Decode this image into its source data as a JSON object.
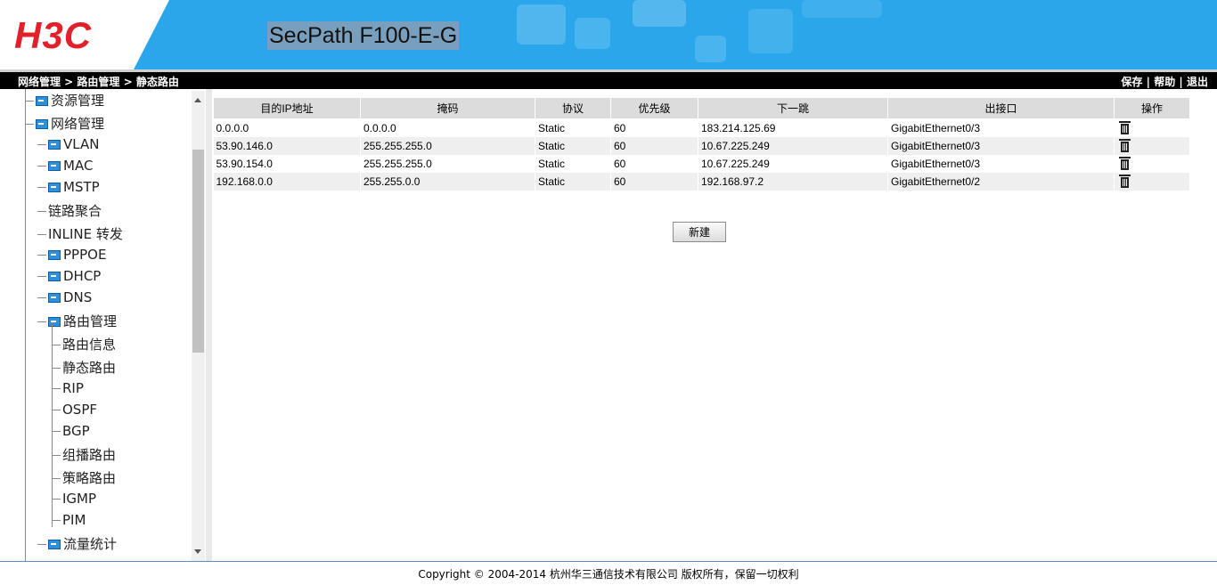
{
  "header": {
    "logo": "H3C",
    "device_title": "SecPath F100-E-G"
  },
  "breadcrumb": "网络管理 > 路由管理 > 静态路由",
  "toplinks": {
    "save": "保存",
    "help": "帮助",
    "logout": "退出",
    "sep": "|"
  },
  "sidebar": {
    "items": [
      {
        "label": "资源管理",
        "level": 0,
        "icon": true
      },
      {
        "label": "网络管理",
        "level": 0,
        "icon": true
      },
      {
        "label": "VLAN",
        "level": 1,
        "icon": true
      },
      {
        "label": "MAC",
        "level": 1,
        "icon": true
      },
      {
        "label": "MSTP",
        "level": 1,
        "icon": true
      },
      {
        "label": "链路聚合",
        "level": 1,
        "icon": false
      },
      {
        "label": "INLINE 转发",
        "level": 1,
        "icon": false
      },
      {
        "label": "PPPOE",
        "level": 1,
        "icon": true
      },
      {
        "label": "DHCP",
        "level": 1,
        "icon": true
      },
      {
        "label": "DNS",
        "level": 1,
        "icon": true
      },
      {
        "label": "路由管理",
        "level": 1,
        "icon": true
      },
      {
        "label": "路由信息",
        "level": 2,
        "icon": false
      },
      {
        "label": "静态路由",
        "level": 2,
        "icon": false
      },
      {
        "label": "RIP",
        "level": 2,
        "icon": false
      },
      {
        "label": "OSPF",
        "level": 2,
        "icon": false
      },
      {
        "label": "BGP",
        "level": 2,
        "icon": false
      },
      {
        "label": "组播路由",
        "level": 2,
        "icon": false
      },
      {
        "label": "策略路由",
        "level": 2,
        "icon": false
      },
      {
        "label": "IGMP",
        "level": 2,
        "icon": false
      },
      {
        "label": "PIM",
        "level": 2,
        "icon": false
      },
      {
        "label": "流量统计",
        "level": 1,
        "icon": true
      }
    ]
  },
  "table": {
    "headers": [
      "目的IP地址",
      "掩码",
      "协议",
      "优先级",
      "下一跳",
      "出接口",
      "操作"
    ],
    "rows": [
      [
        "0.0.0.0",
        "0.0.0.0",
        "Static",
        "60",
        "183.214.125.69",
        "GigabitEthernet0/3"
      ],
      [
        "53.90.146.0",
        "255.255.255.0",
        "Static",
        "60",
        "10.67.225.249",
        "GigabitEthernet0/3"
      ],
      [
        "53.90.154.0",
        "255.255.255.0",
        "Static",
        "60",
        "10.67.225.249",
        "GigabitEthernet0/3"
      ],
      [
        "192.168.0.0",
        "255.255.0.0",
        "Static",
        "60",
        "192.168.97.2",
        "GigabitEthernet0/2"
      ]
    ]
  },
  "new_button": "新建",
  "footer": "Copyright © 2004-2014 杭州华三通信技术有限公司 版权所有，保留一切权利"
}
